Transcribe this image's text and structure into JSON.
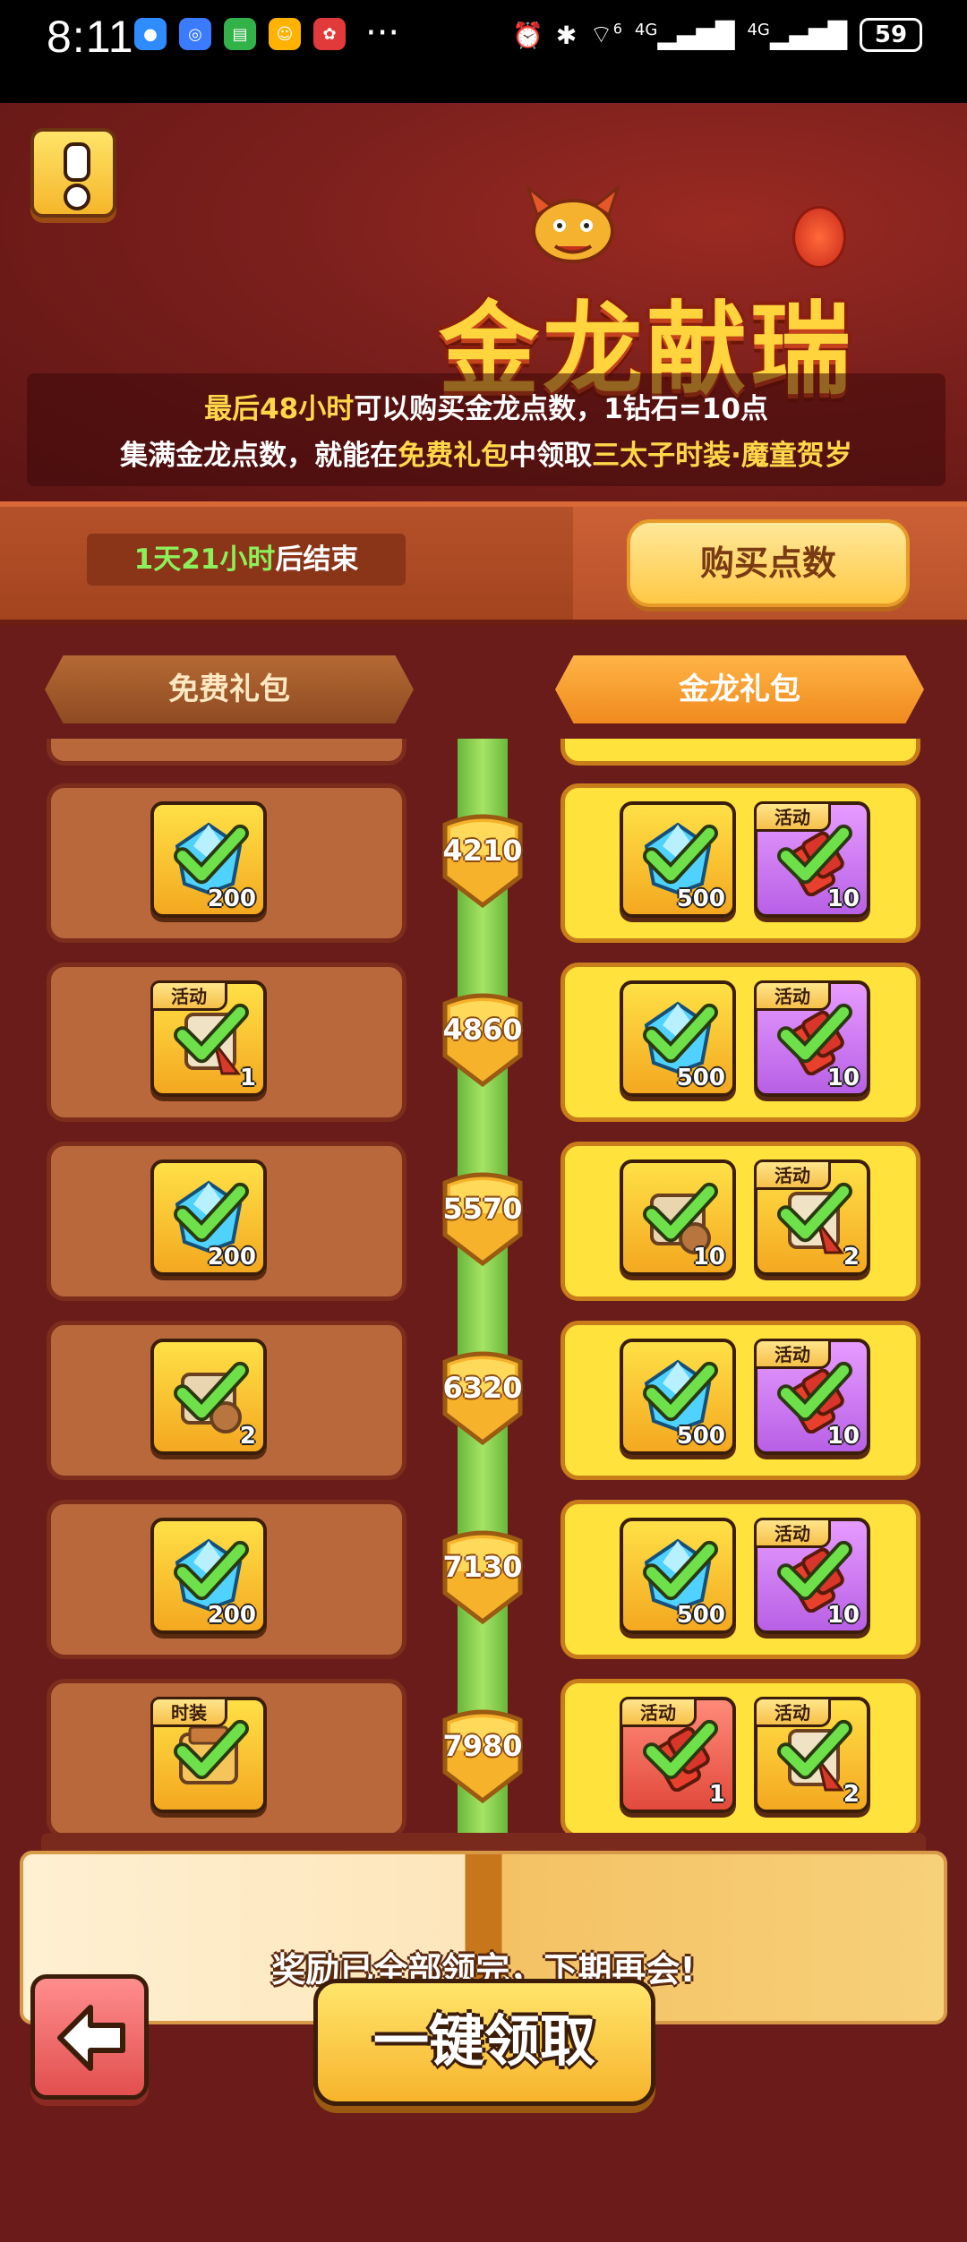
{
  "status_bar": {
    "time": "8:11",
    "more": "···",
    "signal_a": "4G",
    "signal_b": "4G",
    "wifi_sup": "6",
    "battery": "59"
  },
  "header": {
    "title": "金龙献瑞",
    "info_line1": {
      "hl": "最后48小时",
      "rest": "可以购买金龙点数，1钻石=10点"
    },
    "info_line2": {
      "a": "集满金龙点数，就能在",
      "hl1": "免费礼包",
      "b": "中领取",
      "hl2": "三太子时装·魔童贺岁"
    }
  },
  "strip": {
    "timer_hl": "1天21小时",
    "timer_rest": "后结束",
    "buy_label": "购买点数"
  },
  "tabs": {
    "free": "免费礼包",
    "gold": "金龙礼包"
  },
  "rows": [
    {
      "points": "4210",
      "free": [
        {
          "icon": "diamond",
          "bg": "yellow",
          "count": "200"
        }
      ],
      "gold": [
        {
          "icon": "diamond",
          "bg": "yellow",
          "count": "500"
        },
        {
          "icon": "firecracker",
          "bg": "purple",
          "count": "10",
          "tag": "活动"
        }
      ]
    },
    {
      "points": "4860",
      "free": [
        {
          "icon": "scroll-red",
          "bg": "yellow",
          "count": "1",
          "tag": "活动"
        }
      ],
      "gold": [
        {
          "icon": "diamond",
          "bg": "yellow",
          "count": "500"
        },
        {
          "icon": "firecracker",
          "bg": "purple",
          "count": "10",
          "tag": "活动"
        }
      ]
    },
    {
      "points": "5570",
      "free": [
        {
          "icon": "diamond",
          "bg": "yellow",
          "count": "200"
        }
      ],
      "gold": [
        {
          "icon": "scroll",
          "bg": "yellow",
          "count": "10"
        },
        {
          "icon": "scroll-red",
          "bg": "yellow",
          "count": "2",
          "tag": "活动"
        }
      ]
    },
    {
      "points": "6320",
      "free": [
        {
          "icon": "scroll",
          "bg": "yellow",
          "count": "2"
        }
      ],
      "gold": [
        {
          "icon": "diamond",
          "bg": "yellow",
          "count": "500"
        },
        {
          "icon": "firecracker",
          "bg": "purple",
          "count": "10",
          "tag": "活动"
        }
      ]
    },
    {
      "points": "7130",
      "free": [
        {
          "icon": "diamond",
          "bg": "yellow",
          "count": "200"
        }
      ],
      "gold": [
        {
          "icon": "diamond",
          "bg": "yellow",
          "count": "500"
        },
        {
          "icon": "firecracker",
          "bg": "purple",
          "count": "10",
          "tag": "活动"
        }
      ]
    },
    {
      "points": "7980",
      "free": [
        {
          "icon": "costume",
          "bg": "yellow",
          "count": "",
          "tag": "时装"
        }
      ],
      "gold": [
        {
          "icon": "firecracker",
          "bg": "red",
          "count": "1",
          "tag": "活动"
        },
        {
          "icon": "scroll-red",
          "bg": "yellow",
          "count": "2",
          "tag": "活动"
        }
      ]
    }
  ],
  "footer": {
    "message": "奖励已全部领完，下期再会!",
    "claim_label": "一键领取"
  }
}
